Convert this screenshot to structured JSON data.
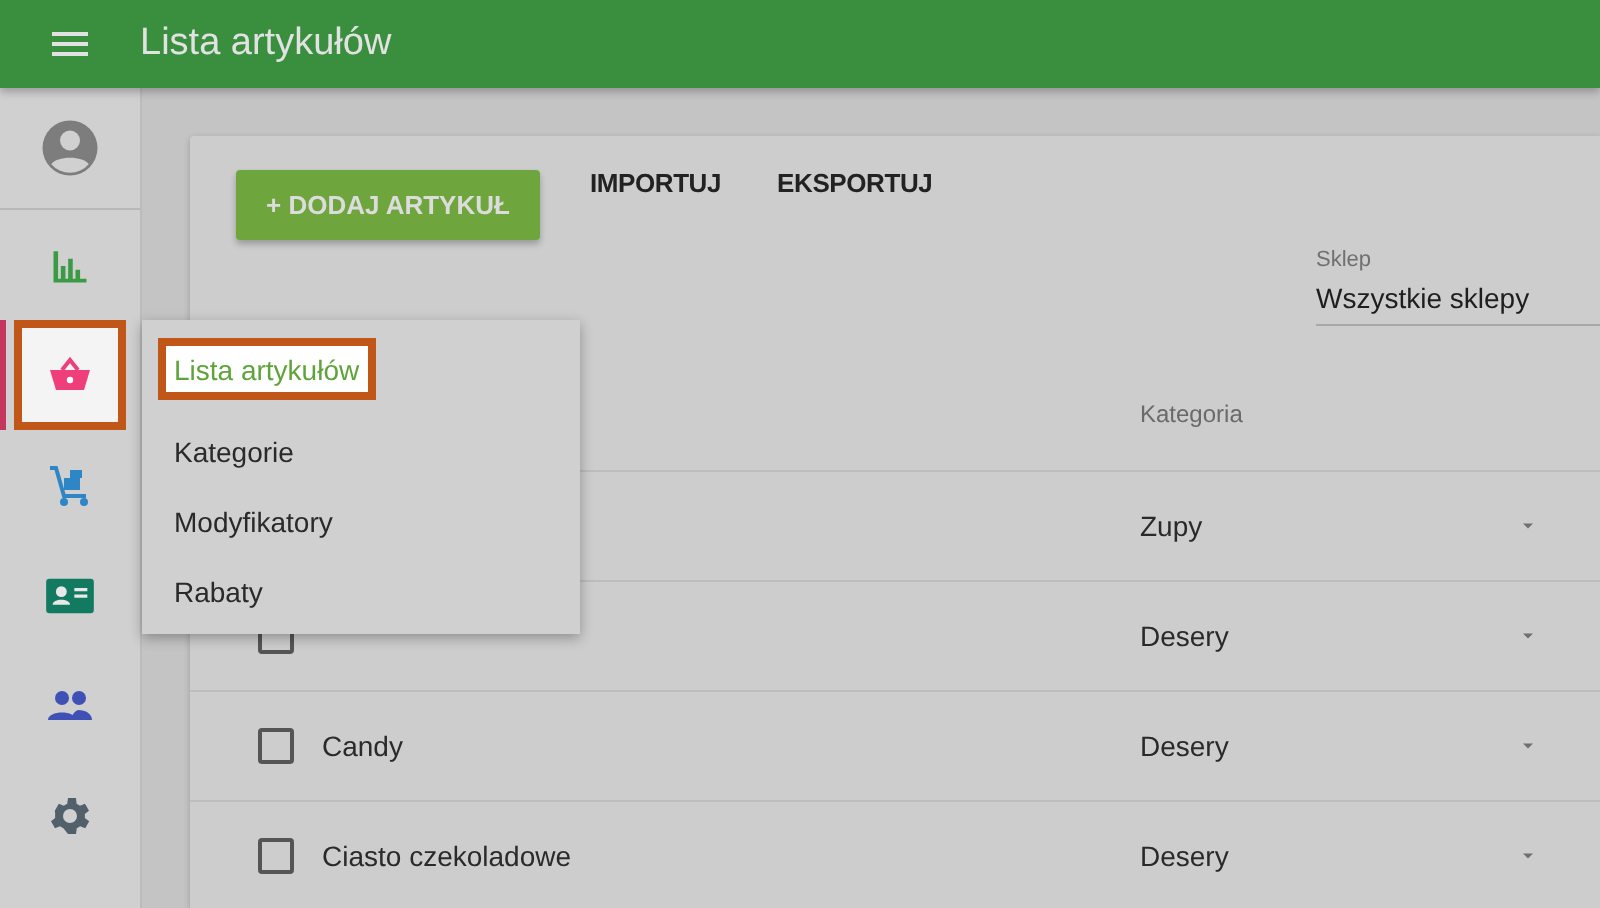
{
  "header": {
    "title": "Lista artykułów"
  },
  "sidebar": {
    "items": [
      {
        "kind": "account",
        "selected": false
      },
      {
        "kind": "reports",
        "selected": false
      },
      {
        "kind": "items",
        "selected": true
      },
      {
        "kind": "inventory",
        "selected": false
      },
      {
        "kind": "customers",
        "selected": false
      },
      {
        "kind": "employees",
        "selected": false
      },
      {
        "kind": "settings",
        "selected": false
      }
    ]
  },
  "submenu": [
    {
      "label": "Lista artykułów",
      "selected": true
    },
    {
      "label": "Kategorie",
      "selected": false
    },
    {
      "label": "Modyfikatory",
      "selected": false
    },
    {
      "label": "Rabaty",
      "selected": false
    }
  ],
  "toolbar": {
    "add_button": "+ DODAJ ARTYKUŁ",
    "actions": [
      "IMPORTUJ",
      "EKSPORTUJ"
    ]
  },
  "store_select": {
    "label": "Sklep",
    "value": "Wszystkie sklepy"
  },
  "table": {
    "columns": [
      "Kategoria"
    ],
    "rows": [
      {
        "category": "Zupy"
      },
      {
        "category": "Desery",
        "checked": false
      },
      {
        "name": "Candy",
        "category": "Desery",
        "checked": false
      },
      {
        "name": "Ciasto czekoladowe",
        "category": "Desery",
        "checked": false
      }
    ]
  }
}
